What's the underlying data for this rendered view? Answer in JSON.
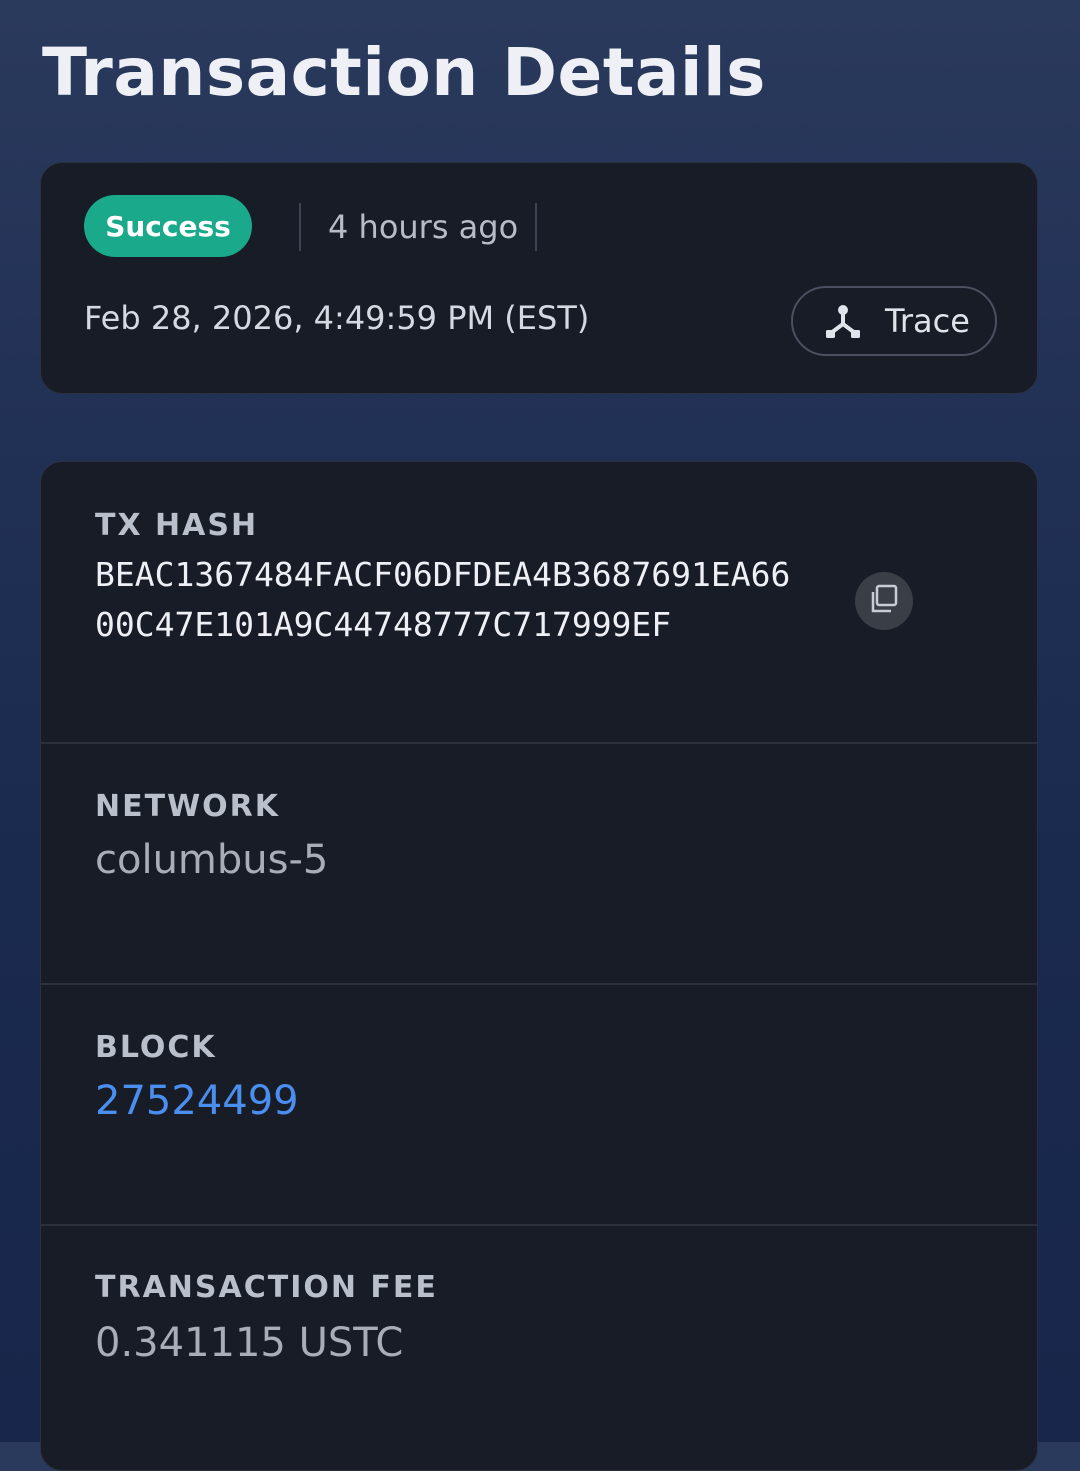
{
  "page": {
    "title": "Transaction Details"
  },
  "status_card": {
    "status": "Success",
    "time_ago": "4 hours ago",
    "timestamp": "Feb 28, 2026, 4:49:59 PM (EST)",
    "trace_label": "Trace",
    "trace_icon": "trace-fork-icon"
  },
  "details": {
    "tx_hash": {
      "label": "TX HASH",
      "value": "BEAC1367484FACF06DFDEA4B3687691EA6600C47E101A9C44748777C717999EF",
      "copy_icon": "copy-icon"
    },
    "network": {
      "label": "NETWORK",
      "value": "columbus-5"
    },
    "block": {
      "label": "BLOCK",
      "value": "27524499"
    },
    "fee": {
      "label": "TRANSACTION FEE",
      "value": "0.341115 USTC"
    }
  },
  "colors": {
    "success": "#1aa98a",
    "link": "#4a8ff0",
    "card": "#181c26"
  }
}
